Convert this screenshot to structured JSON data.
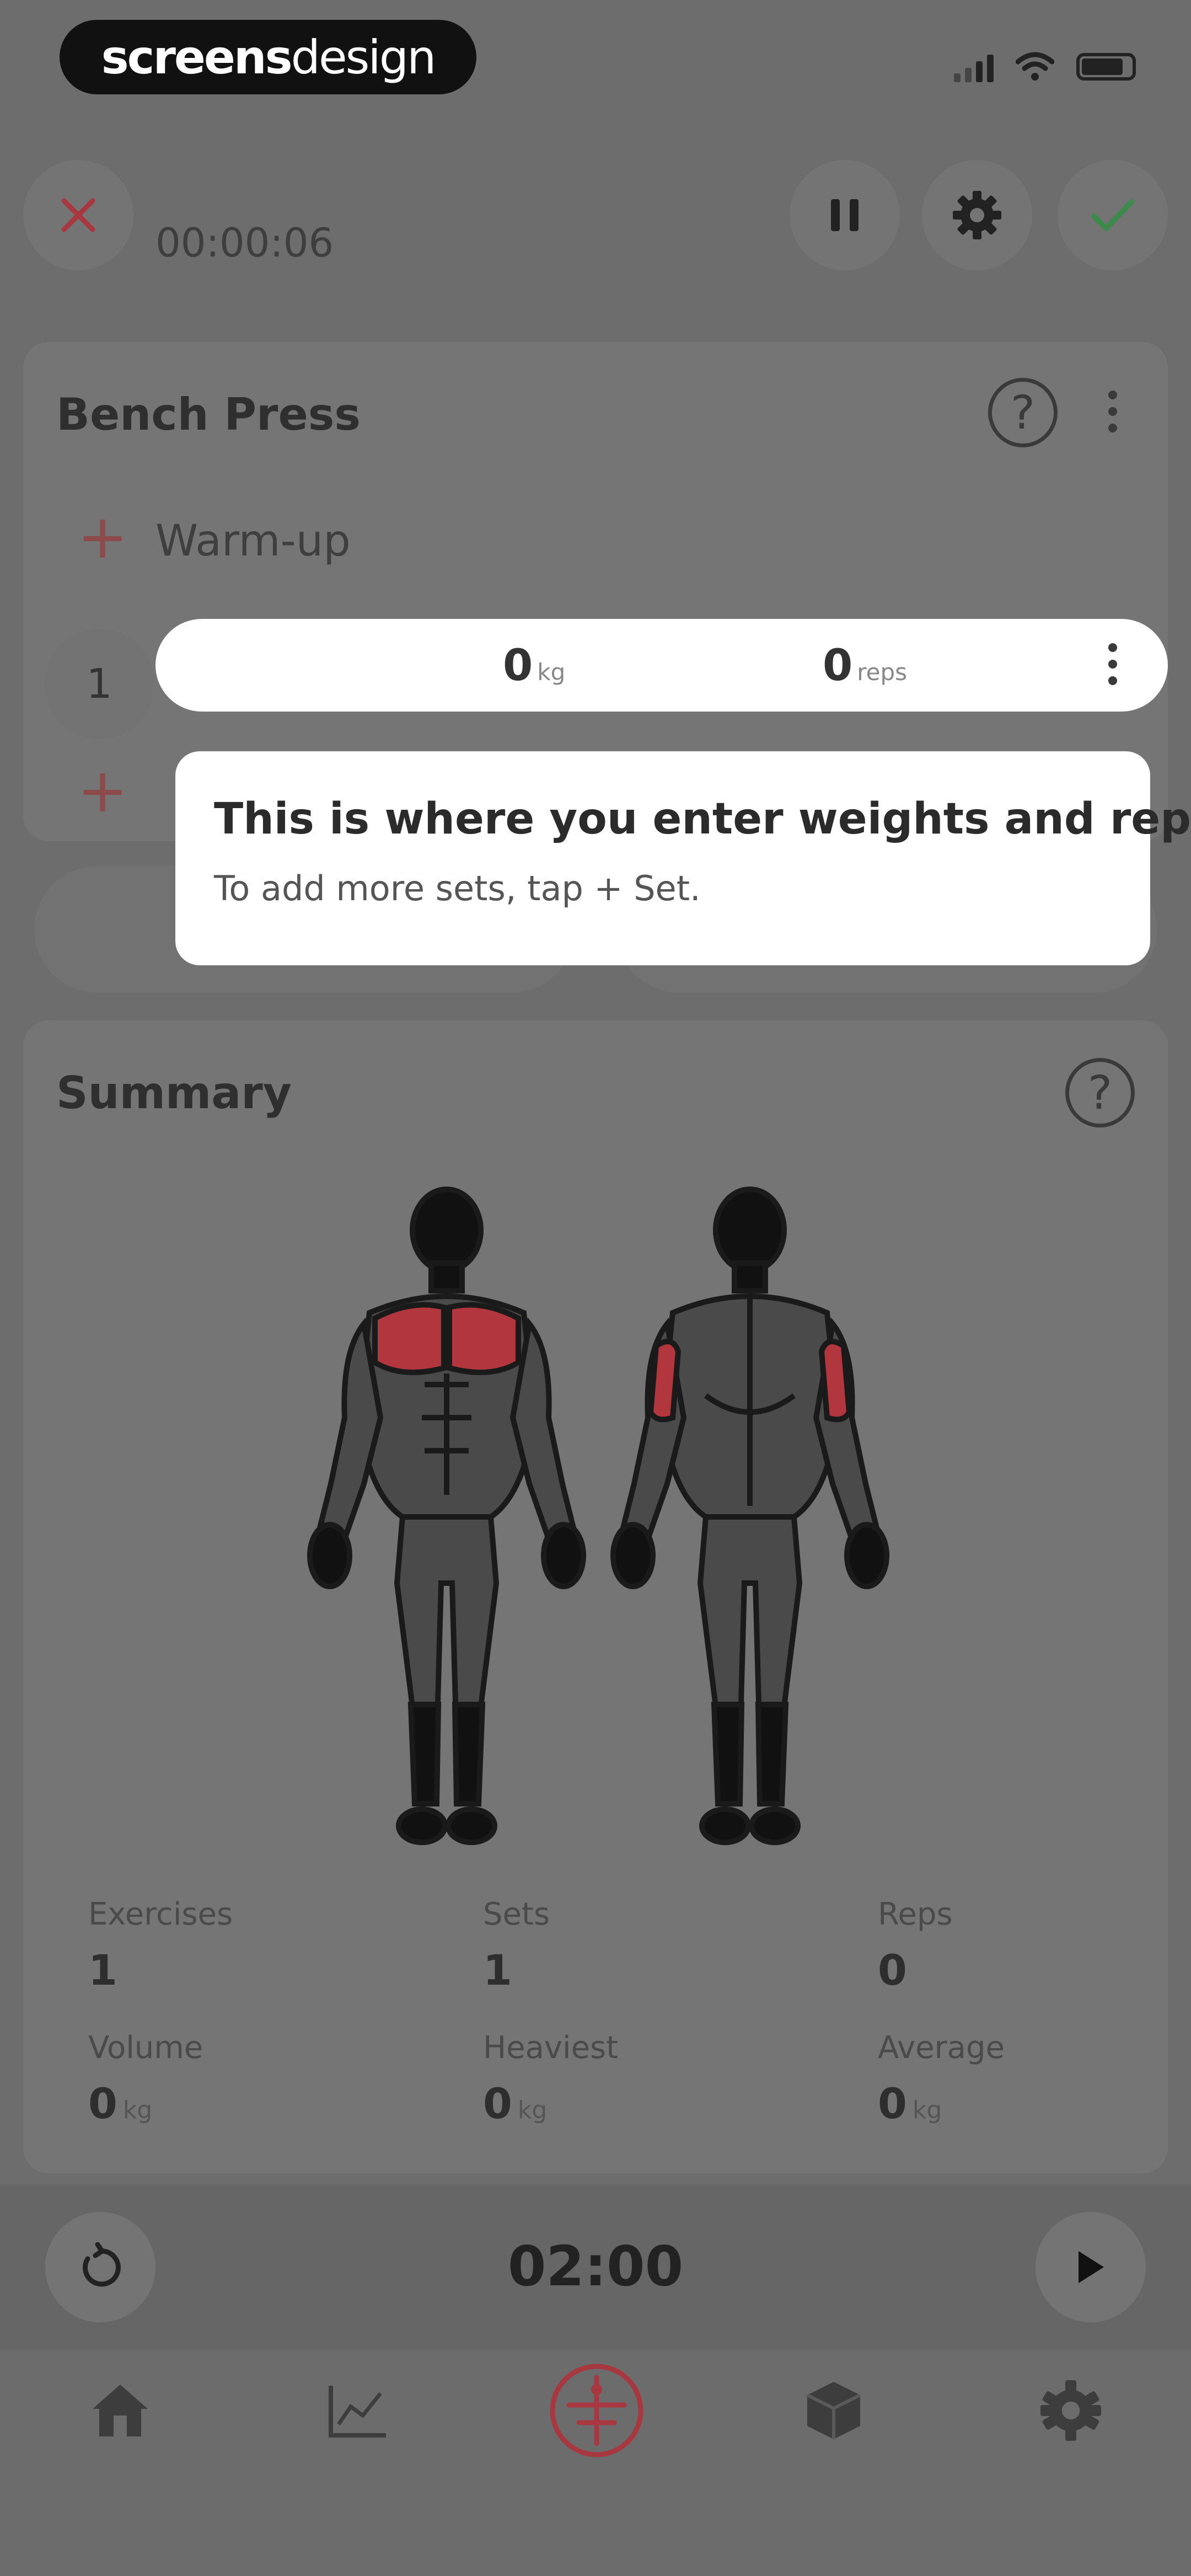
{
  "status_bar": {
    "brand_bold": "screens",
    "brand_thin": "design"
  },
  "header": {
    "timer": "00:00:06",
    "accent_red": "#b33a3a",
    "accent_green": "#3a8a4a"
  },
  "exercise": {
    "name": "Bench Press",
    "warmup_label": "Warm-up",
    "set_number": "1",
    "weight_value": "0",
    "weight_unit": "kg",
    "reps_value": "0",
    "reps_unit": "reps"
  },
  "tooltip": {
    "title": "This is where you enter weights and reps",
    "body": "To add more sets, tap + Set."
  },
  "summary": {
    "title": "Summary",
    "muscle_highlight": "#c23a42",
    "stats": [
      {
        "label": "Exercises",
        "value": "1",
        "unit": ""
      },
      {
        "label": "Sets",
        "value": "1",
        "unit": ""
      },
      {
        "label": "Reps",
        "value": "0",
        "unit": ""
      },
      {
        "label": "Volume",
        "value": "0",
        "unit": "kg"
      },
      {
        "label": "Heaviest",
        "value": "0",
        "unit": "kg"
      },
      {
        "label": "Average",
        "value": "0",
        "unit": "kg"
      }
    ]
  },
  "rest_timer": {
    "time": "02:00"
  },
  "tab_bar": {
    "items": [
      "home-icon",
      "chart-icon",
      "workout-icon",
      "cube-icon",
      "settings-icon"
    ],
    "active": "workout-icon"
  }
}
